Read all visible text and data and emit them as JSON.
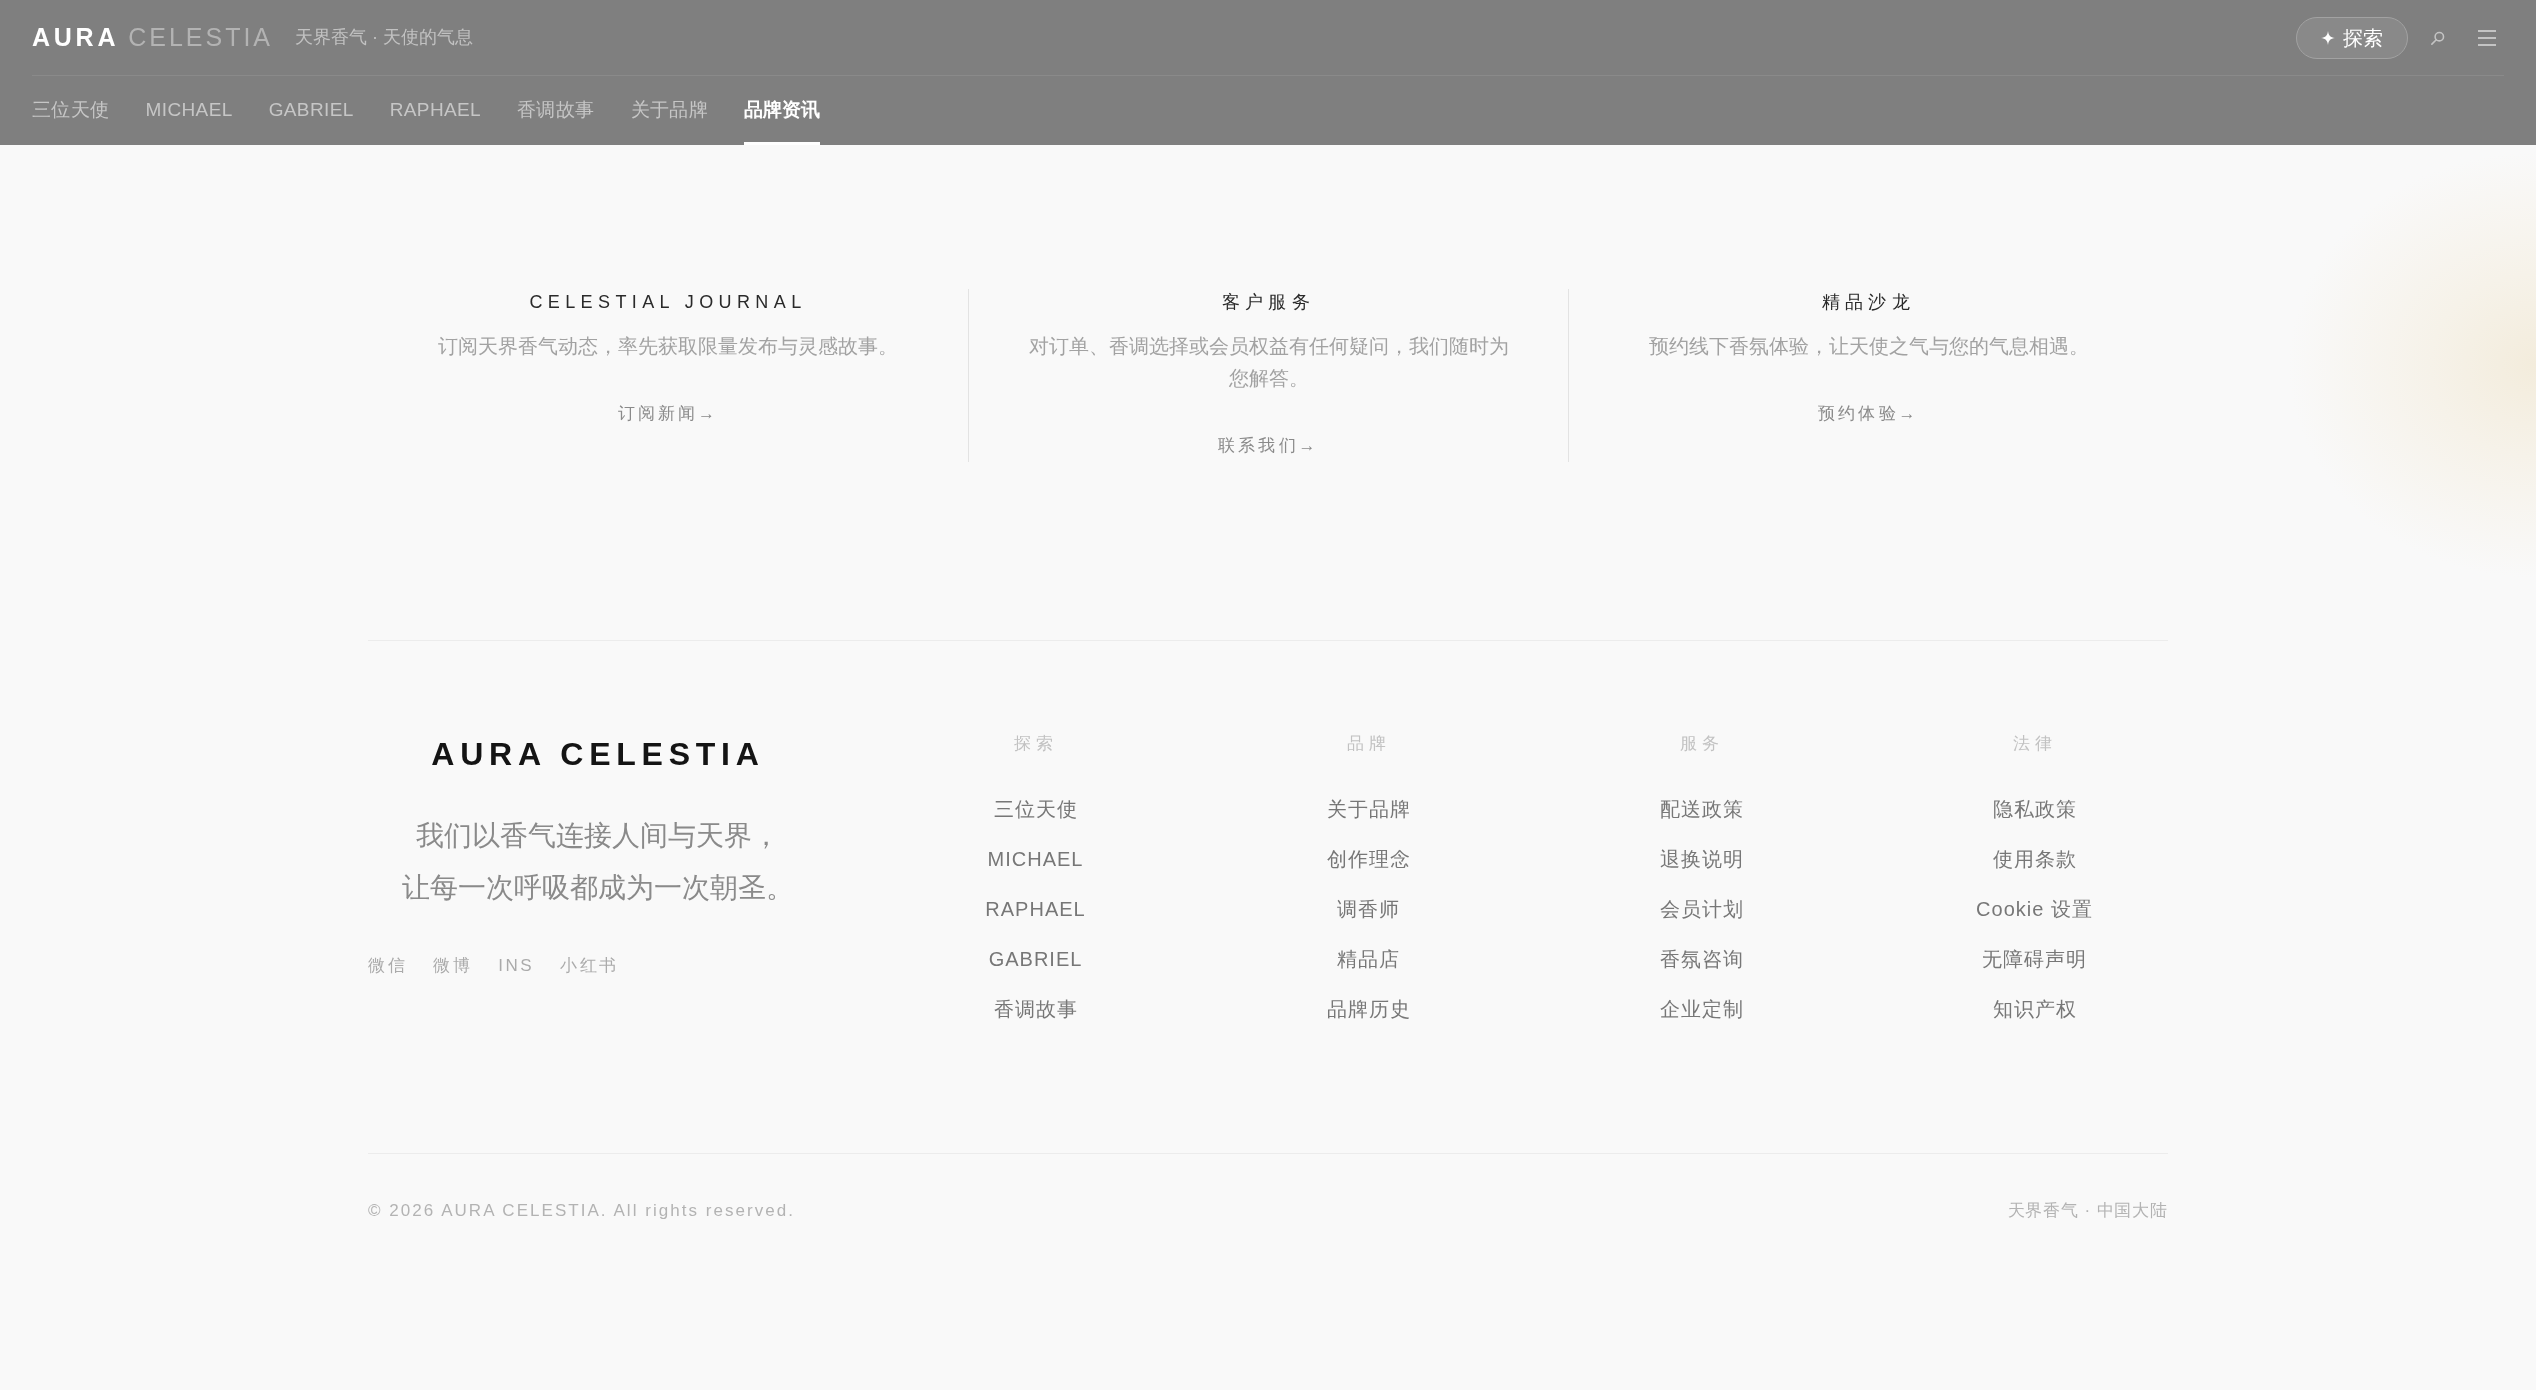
{
  "header": {
    "logo": {
      "primary": "AURA",
      "secondary": "CELESTIA"
    },
    "tagline": "天界香气 · 天使的气息",
    "explore_button": "探索",
    "nav": [
      {
        "label": "三位天使",
        "selected": false
      },
      {
        "label": "MICHAEL",
        "selected": false
      },
      {
        "label": "GABRIEL",
        "selected": false
      },
      {
        "label": "RAPHAEL",
        "selected": false
      },
      {
        "label": "香调故事",
        "selected": false
      },
      {
        "label": "关于品牌",
        "selected": false
      },
      {
        "label": "品牌资讯",
        "selected": true
      }
    ]
  },
  "cards": [
    {
      "title": "CELESTIAL JOURNAL",
      "description": "订阅天界香气动态，率先获取限量发布与灵感故事。",
      "link": "订阅新闻→"
    },
    {
      "title": "客户服务",
      "description": "对订单、香调选择或会员权益有任何疑问，我们随时为您解答。",
      "link": "联系我们→"
    },
    {
      "title": "精品沙龙",
      "description": "预约线下香氛体验，让天使之气与您的气息相遇。",
      "link": "预约体验→"
    }
  ],
  "footer": {
    "brand": "AURA CELESTIA",
    "tagline": [
      "我们以香气连接人间与天界，",
      "让每一次呼吸都成为一次朝圣。"
    ],
    "social": [
      "微信",
      "微博",
      "INS",
      "小红书"
    ],
    "columns": [
      {
        "heading": "探索",
        "links": [
          "三位天使",
          "MICHAEL",
          "RAPHAEL",
          "GABRIEL",
          "香调故事"
        ]
      },
      {
        "heading": "品牌",
        "links": [
          "关于品牌",
          "创作理念",
          "调香师",
          "精品店",
          "品牌历史"
        ]
      },
      {
        "heading": "服务",
        "links": [
          "配送政策",
          "退换说明",
          "会员计划",
          "香氛咨询",
          "企业定制"
        ]
      },
      {
        "heading": "法律",
        "links": [
          "隐私政策",
          "使用条款",
          "Cookie 设置",
          "无障碍声明",
          "知识产权"
        ]
      }
    ],
    "copyright": "© 2026 AURA CELESTIA. All rights reserved.",
    "region": "天界香气 · 中国大陆"
  }
}
